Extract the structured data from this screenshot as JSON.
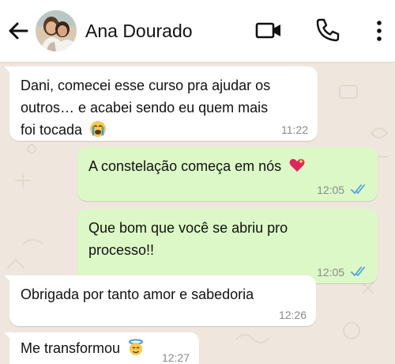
{
  "header": {
    "contact_name": "Ana Dourado",
    "icons": [
      "back-arrow-icon",
      "avatar",
      "video-call-icon",
      "phone-call-icon",
      "more-options-icon"
    ]
  },
  "messages": [
    {
      "direction": "incoming",
      "lines": [
        "Dani, comecei esse curso pra ajudar os",
        "outros… e acabei sendo eu quem mais",
        "foi tocada"
      ],
      "emoji": "crying-face-icon",
      "time": "11:22"
    },
    {
      "direction": "outgoing",
      "lines": [
        "A constelação começa em nós"
      ],
      "emoji": "sparkling-heart-icon",
      "time": "12:05",
      "status": "read"
    },
    {
      "direction": "outgoing",
      "lines": [
        "Que bom que você se abriu pro",
        "processo!!"
      ],
      "time": "12:05",
      "status": "read"
    },
    {
      "direction": "incoming",
      "lines": [
        "Obrigada por tanto amor e sabedoria"
      ],
      "time": "12:26"
    },
    {
      "direction": "incoming",
      "lines": [
        "Me transformou"
      ],
      "emoji": "face-with-halo-icon",
      "time": "12:27"
    }
  ],
  "colors": {
    "incoming_bubble": "#ffffff",
    "outgoing_bubble": "#dcf8c6",
    "read_ticks": "#4fa3e0",
    "chat_background": "#efe7dd"
  }
}
